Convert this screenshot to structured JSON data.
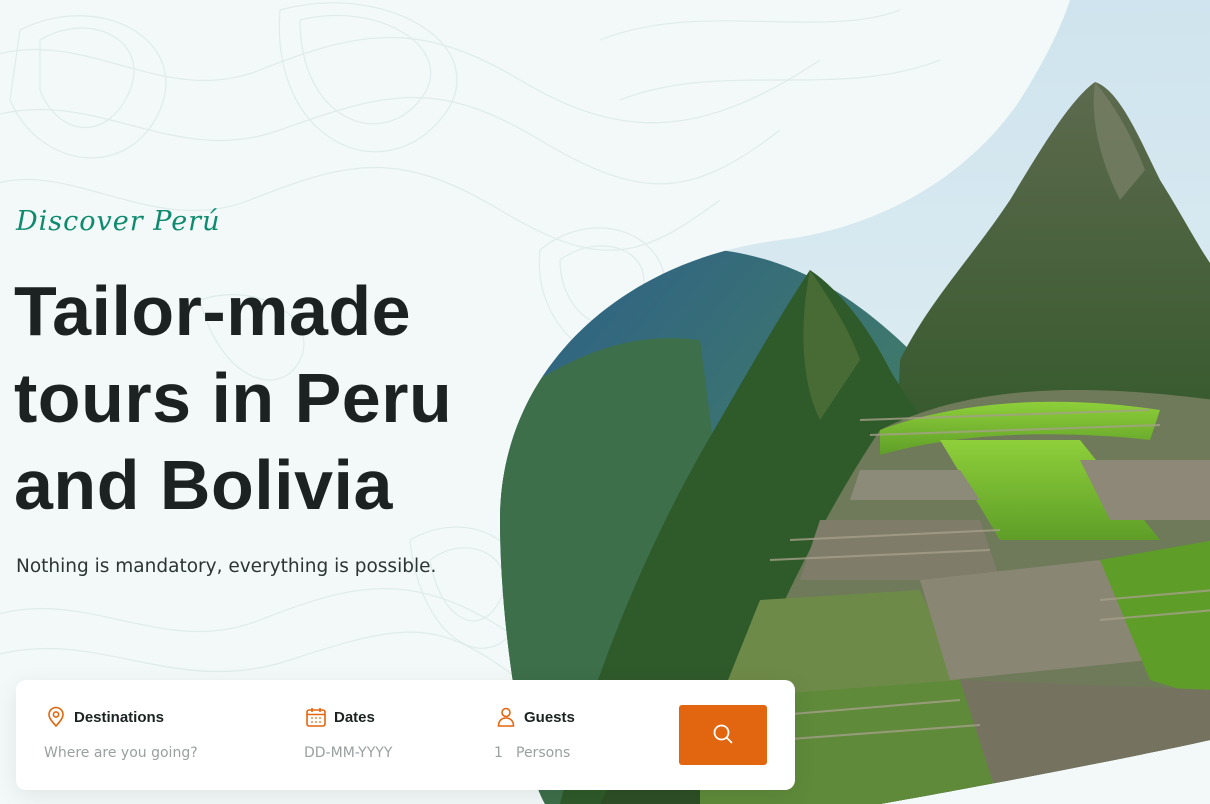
{
  "hero": {
    "tagline": "Discover Perú",
    "headline_lines": [
      "Tailor-made",
      "tours in Peru",
      "and Bolivia"
    ],
    "subtitle": "Nothing is mandatory, everything is possible.",
    "image_subject": "Machu Picchu mountain ruins"
  },
  "search": {
    "destinations": {
      "label": "Destinations",
      "placeholder": "Where are you going?",
      "icon": "map-pin-icon"
    },
    "dates": {
      "label": "Dates",
      "placeholder": "DD-MM-YYYY",
      "icon": "calendar-icon"
    },
    "guests": {
      "label": "Guests",
      "count": "1",
      "unit": "Persons",
      "icon": "user-icon"
    },
    "button": {
      "icon": "search-icon"
    }
  },
  "colors": {
    "background": "#f2f9f8",
    "accent_orange": "#e2660f",
    "tagline_green": "#0e8a6e",
    "text_dark": "#1c2222"
  }
}
